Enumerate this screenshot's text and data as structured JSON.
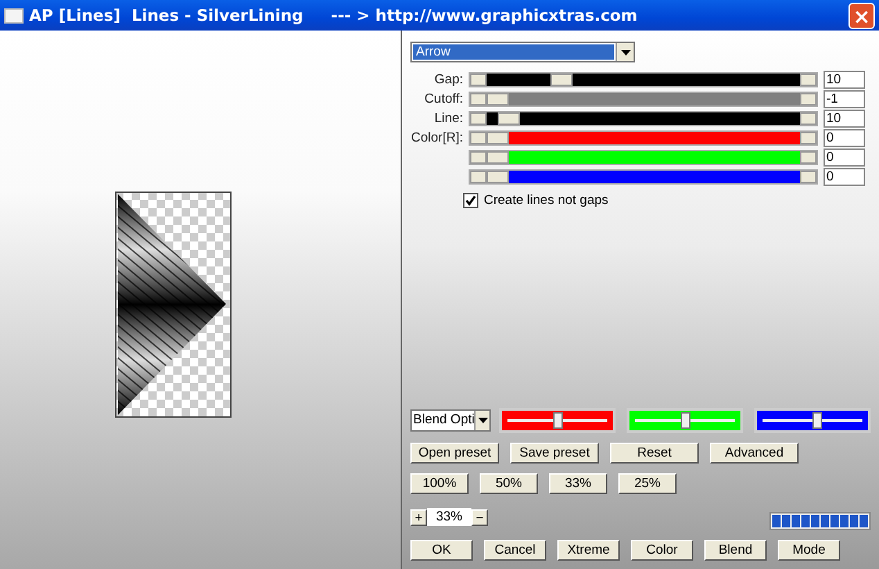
{
  "window": {
    "title": "AP [Lines]  Lines - SilverLining     --- > http://www.graphicxtras.com",
    "close": "×"
  },
  "preset_dropdown": {
    "value": "Arrow"
  },
  "sliders": [
    {
      "label": "Gap:",
      "level": 0.22,
      "color": "#000000",
      "value": "10"
    },
    {
      "label": "Cutoff:",
      "level": 0.0,
      "color": "#808080",
      "value": "-1"
    },
    {
      "label": "Line:",
      "level": 0.04,
      "color": "#000000",
      "value": "10"
    },
    {
      "label": "Color[R]:",
      "level": 0.0,
      "color": "#ff0000",
      "value": "0"
    },
    {
      "level": 0.0,
      "color": "#00ff00",
      "value": "0"
    },
    {
      "level": 0.0,
      "color": "#0000ff",
      "value": "0"
    }
  ],
  "checkbox": {
    "label": "Create lines not gaps",
    "checked": true
  },
  "blend_dropdown": {
    "value": "Blend Opti"
  },
  "blend_sliders": [
    {
      "color": "#ff0000",
      "level": 0.5
    },
    {
      "color": "#00ff00",
      "level": 0.5
    },
    {
      "color": "#0000ff",
      "level": 0.55
    }
  ],
  "preset_buttons": [
    "Open preset",
    "Save preset",
    "Reset",
    "Advanced"
  ],
  "zoom_buttons": [
    "100%",
    "50%",
    "33%",
    "25%"
  ],
  "zoom_control": {
    "plus": "+",
    "value": "33%",
    "minus": "−"
  },
  "progress": {
    "level": 1
  },
  "action_buttons": [
    "OK",
    "Cancel",
    "Xtreme",
    "Color",
    "Blend",
    "Mode"
  ]
}
